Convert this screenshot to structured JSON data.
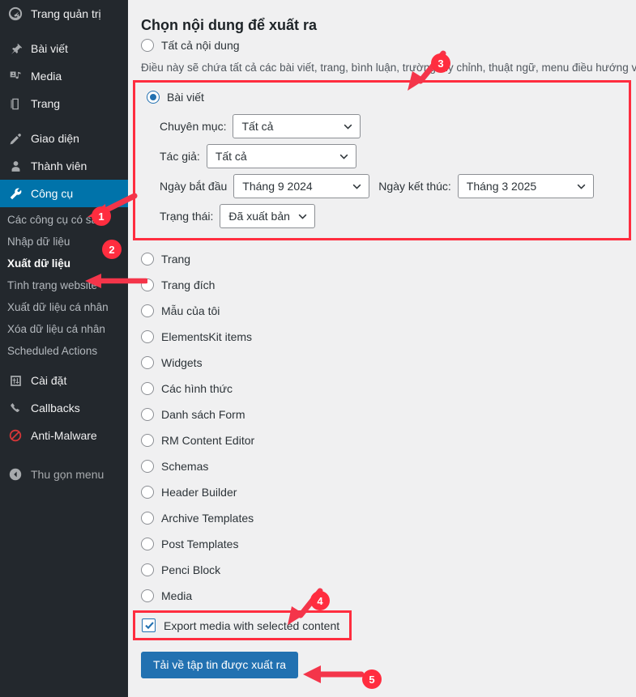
{
  "theme": {
    "sidebar_bg": "#23282d",
    "sidebar_active_bg": "#0073aa",
    "content_bg": "#f0f0f1",
    "accent_blue": "#2271b1",
    "annotation_red": "#ff2d3f"
  },
  "sidebar": {
    "top_items": [
      {
        "label": "Trang quản trị",
        "icon": "dashboard-icon",
        "active": false
      },
      {
        "label": "Bài viết",
        "icon": "pin-icon",
        "active": false
      },
      {
        "label": "Media",
        "icon": "media-icon",
        "active": false
      },
      {
        "label": "Trang",
        "icon": "page-icon",
        "active": false
      },
      {
        "label": "Giao diện",
        "icon": "appearance-brush-icon",
        "active": false
      },
      {
        "label": "Thành viên",
        "icon": "users-icon",
        "active": false
      },
      {
        "label": "Công cụ",
        "icon": "wrench-icon",
        "active": true
      }
    ],
    "tools_submenu": [
      {
        "label": "Các công cụ có sẵn",
        "current": false
      },
      {
        "label": "Nhập dữ liệu",
        "current": false
      },
      {
        "label": "Xuất dữ liệu",
        "current": true
      },
      {
        "label": "Tình trạng website",
        "current": false
      },
      {
        "label": "Xuất dữ liệu cá nhân",
        "current": false
      },
      {
        "label": "Xóa dữ liệu cá nhân",
        "current": false
      },
      {
        "label": "Scheduled Actions",
        "current": false
      }
    ],
    "bottom_items": [
      {
        "label": "Cài đặt",
        "icon": "settings-sliders-icon"
      },
      {
        "label": "Callbacks",
        "icon": "phone-icon"
      },
      {
        "label": "Anti-Malware",
        "icon": "anti-malware-shield-icon"
      }
    ],
    "collapse": {
      "label": "Thu gọn menu",
      "icon": "collapse-left-icon"
    }
  },
  "main": {
    "clipped_top_text": "",
    "heading": "Chọn nội dung để xuất ra",
    "all_content_option": "Tất cả nội dung",
    "all_content_desc": "Điều này sẽ chứa tất cả các bài viết, trang, bình luận, trường tùy chỉnh, thuật ngữ, menu điều hướng v",
    "posts_block": {
      "option_label": "Bài viết",
      "selected": true,
      "fields": [
        {
          "name": "categories",
          "label": "Chuyên mục:",
          "value": "Tất cả"
        },
        {
          "name": "authors",
          "label": "Tác giả:",
          "value": "Tất cả"
        },
        {
          "name": "start_date",
          "label": "Ngày bắt đầu",
          "value": "Tháng 9 2024"
        },
        {
          "name": "end_date",
          "label": "Ngày kết thúc:",
          "value": "Tháng 3 2025"
        },
        {
          "name": "status",
          "label": "Trạng thái:",
          "value": "Đã xuất bản"
        }
      ]
    },
    "content_types": [
      "Trang",
      "Trang đích",
      "Mẫu của tôi",
      "ElementsKit items",
      "Widgets",
      "Các hình thức",
      "Danh sách Form",
      "RM Content Editor",
      "Schemas",
      "Header Builder",
      "Archive Templates",
      "Post Templates",
      "Penci Block",
      "Media"
    ],
    "export_media_checkbox": {
      "label": "Export media with selected content",
      "checked": true
    },
    "download_button": "Tải về tập tin được xuất ra"
  },
  "annotations": {
    "badges": [
      {
        "id": "1",
        "text": "1",
        "target": "sidebar-item-tools"
      },
      {
        "id": "2",
        "text": "2",
        "target": "sidebar-subitem-export"
      },
      {
        "id": "3",
        "text": "3",
        "target": "posts-option"
      },
      {
        "id": "4",
        "text": "4",
        "target": "export-media-checkbox"
      },
      {
        "id": "5",
        "text": "5",
        "target": "download-button"
      }
    ]
  }
}
